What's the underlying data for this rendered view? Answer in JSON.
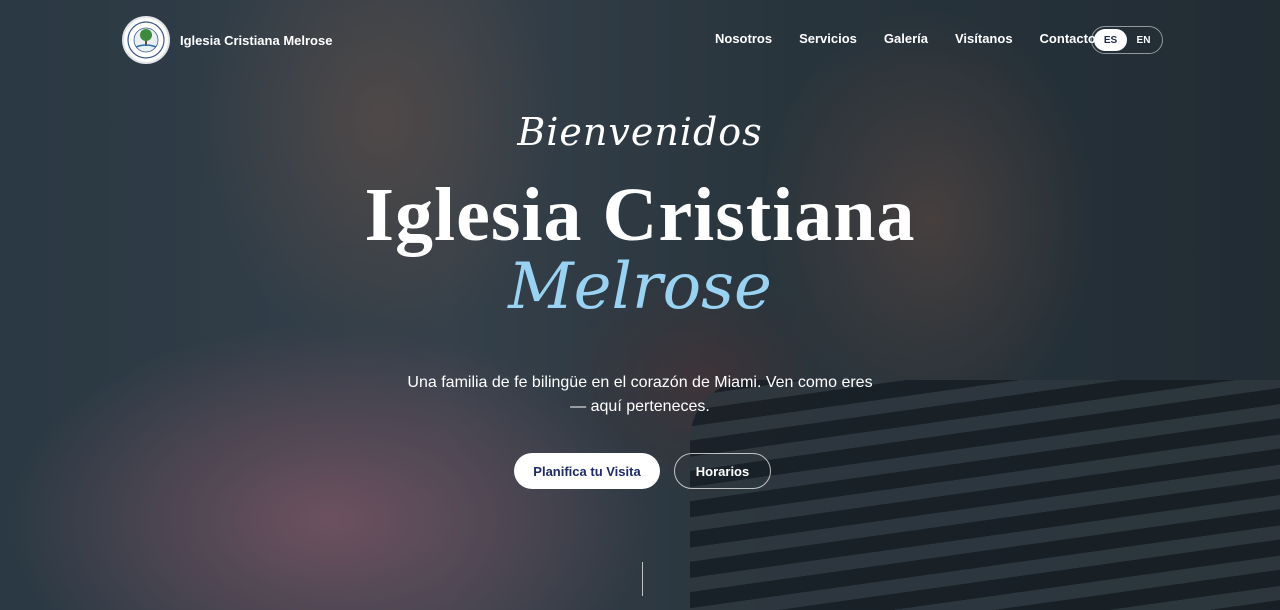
{
  "header": {
    "brand_name": "Iglesia Cristiana Melrose",
    "logo_icon": "church-seal-logo",
    "nav": [
      {
        "label": "Nosotros"
      },
      {
        "label": "Servicios"
      },
      {
        "label": "Galería"
      },
      {
        "label": "Visítanos"
      },
      {
        "label": "Contacto"
      }
    ],
    "language": {
      "options": [
        "ES",
        "EN"
      ],
      "selected": "ES"
    }
  },
  "hero": {
    "welcome": "Bienvenidos",
    "title": "Iglesia Cristiana",
    "title_accent": "Melrose",
    "subtitle": "Una familia de fe bilingüe en el corazón de Miami. Ven como eres — aquí perteneces.",
    "primary_button": "Planifica tu Visita",
    "secondary_button": "Horarios"
  },
  "colors": {
    "accent": "#9ad3f2",
    "primary_button_text": "#1e2a6a",
    "text": "#ffffff"
  }
}
